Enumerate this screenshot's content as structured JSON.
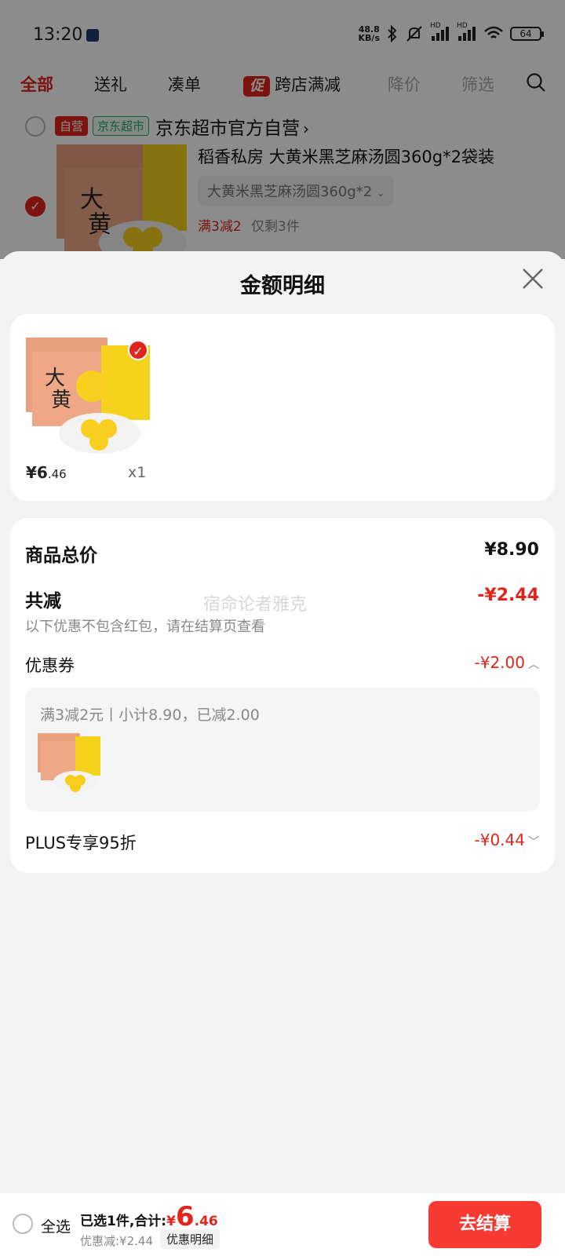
{
  "status_bar": {
    "time": "13:20",
    "net_speed_value": "48.8",
    "net_speed_unit": "KB/s",
    "hd1": "HD",
    "hd2": "HD",
    "battery": "64"
  },
  "tabs": {
    "items": [
      "全部",
      "送礼",
      "凑单",
      "跨店满减",
      "降价",
      "筛选"
    ],
    "promo_badge": "促"
  },
  "shop": {
    "self_badge": "自营",
    "jd_badge": "京东超市",
    "name": "京东超市官方自营",
    "chevron": "›"
  },
  "cart_item": {
    "title": "稻香私房  大黄米黑芝麻汤圆360g*2袋装",
    "spec": "大黄米黑芝麻汤圆360g*2",
    "spec_chevron": "⌄",
    "promo": "满3减2",
    "stock": "仅剩3件"
  },
  "sheet": {
    "title": "金额明细",
    "product": {
      "price_currency": "¥",
      "price_int": "6",
      "price_dec": ".46",
      "qty": "x1"
    },
    "rows": {
      "total_label": "商品总价",
      "total_value": "¥8.90",
      "reduce_label": "共减",
      "reduce_value": "-¥2.44",
      "reduce_note": "以下优惠不包含红包，请在结算页查看",
      "watermark": "宿命论者雅克",
      "coupon_label": "优惠券",
      "coupon_value": "-¥2.00",
      "coupon_detail": "满3减2元丨小计8.90，已减2.00",
      "plus_label": "PLUS专享95折",
      "plus_value": "-¥0.44"
    }
  },
  "bottom_bar": {
    "select_all": "全选",
    "selected_text": "已选1件,合计:",
    "currency": "¥",
    "total_int": "6",
    "total_dec": ".46",
    "discount_text": "优惠减:¥2.44",
    "discount_button": "优惠明细",
    "checkout": "去结算"
  },
  "colors": {
    "accent_red": "#e0251d",
    "checkout_red": "#f73a32",
    "jd_green": "#2ea66e"
  }
}
